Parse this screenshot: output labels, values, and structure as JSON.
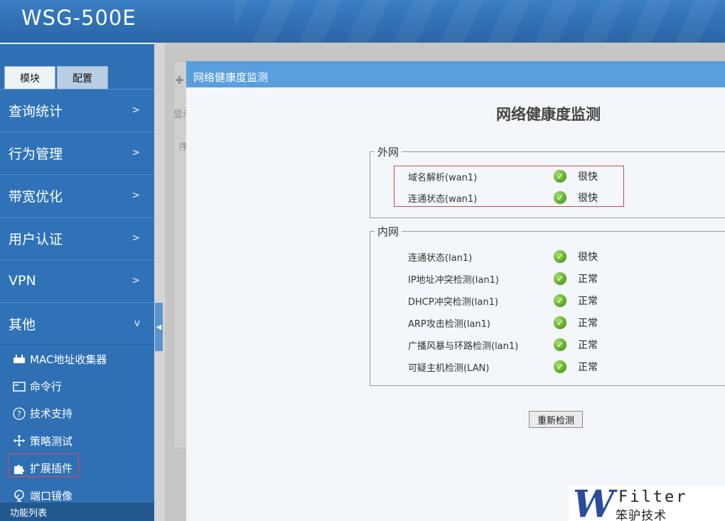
{
  "header": {
    "brand": "WSG-500E"
  },
  "sidebar": {
    "tabs": [
      {
        "label": "模块",
        "active": true
      },
      {
        "label": "配置",
        "active": false
      }
    ],
    "menu": [
      {
        "label": "查询统计",
        "chevron": ">"
      },
      {
        "label": "行为管理",
        "chevron": ">"
      },
      {
        "label": "带宽优化",
        "chevron": ">"
      },
      {
        "label": "用户认证",
        "chevron": ">"
      },
      {
        "label": "VPN",
        "chevron": ">"
      },
      {
        "label": "其他",
        "chevron": "v"
      }
    ],
    "sub_items": [
      {
        "label": "MAC地址收集器",
        "icon": "router-icon"
      },
      {
        "label": "命令行",
        "icon": "terminal-icon"
      },
      {
        "label": "技术支持",
        "icon": "help-icon"
      },
      {
        "label": "策略测试",
        "icon": "move-icon"
      },
      {
        "label": "扩展插件",
        "icon": "puzzle-icon",
        "selected": true
      },
      {
        "label": "端口镜像",
        "icon": "mirror-icon"
      }
    ],
    "footer": "功能列表"
  },
  "background_page": {
    "fragment_1": "显示",
    "fragment_2": "序"
  },
  "modal": {
    "title": "网络健康度监测",
    "heading": "网络健康度监测",
    "wan": {
      "legend": "外网",
      "rows": [
        {
          "label": "域名解析(wan1)",
          "status": "很快"
        },
        {
          "label": "连通状态(wan1)",
          "status": "很快"
        }
      ]
    },
    "lan": {
      "legend": "内网",
      "rows": [
        {
          "label": "连通状态(lan1)",
          "status": "很快"
        },
        {
          "label": "IP地址冲突检测(lan1)",
          "status": "正常"
        },
        {
          "label": "DHCP冲突检测(lan1)",
          "status": "正常"
        },
        {
          "label": "ARP攻击检测(lan1)",
          "status": "正常"
        },
        {
          "label": "广播风暴与环路检测(lan1)",
          "status": "正常"
        },
        {
          "label": "可疑主机检测(LAN)",
          "status": "正常"
        }
      ]
    },
    "recheck_button": "重新检测"
  },
  "watermark": {
    "mark": "W",
    "text_en": "Filter",
    "text_cn": "笨驴技术"
  },
  "colors": {
    "header": "#2f6fb2",
    "sidebar": "#2f72b8",
    "modal_title": "#5a9fdd",
    "ok_green": "#52a21c",
    "highlight": "#d9474a"
  }
}
